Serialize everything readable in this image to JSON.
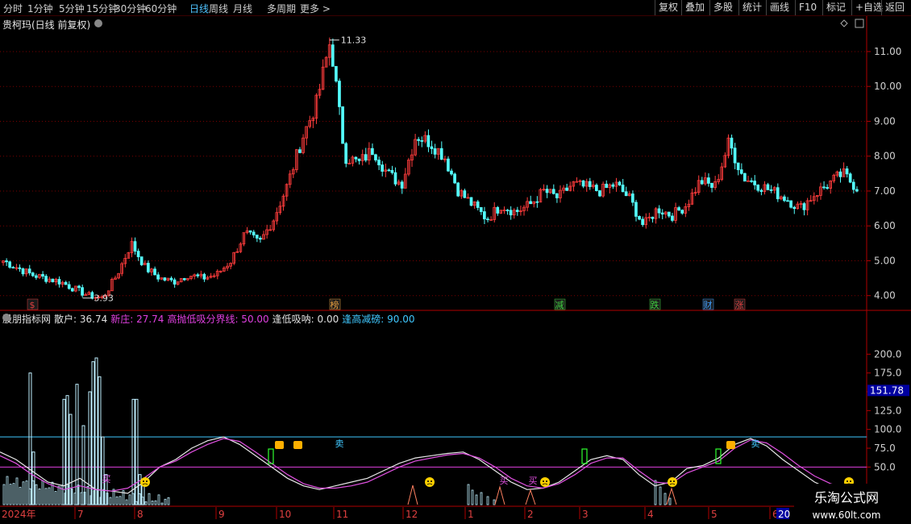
{
  "toolbar": {
    "periods": [
      "分时",
      "1分钟",
      "5分钟",
      "15分钟",
      "30分钟",
      "60分钟",
      "日线",
      "周线",
      "月线",
      "多周期",
      "更多 >"
    ],
    "active_period": "日线",
    "buttons": [
      "复权",
      "叠加",
      "多股",
      "统计",
      "画线",
      "F10",
      "标记",
      "+自选",
      "返回"
    ]
  },
  "price_panel": {
    "title": "贵柯玛(日线 前复权)",
    "high_label": "11.33",
    "low_label": "3.93",
    "event_markers": [
      {
        "text": "$",
        "color": "#e04040"
      },
      {
        "text": "榜",
        "color": "#e8a040"
      },
      {
        "text": "减",
        "color": "#40d040"
      },
      {
        "text": "跌",
        "color": "#40d040"
      },
      {
        "text": "财",
        "color": "#40a0ff"
      },
      {
        "text": "涨",
        "color": "#e04040"
      }
    ]
  },
  "indicator_panel": {
    "name": "股朋指标网",
    "items": [
      {
        "label": "散户: 36.74",
        "color": "#e0e0e0"
      },
      {
        "label": "新庄: 27.74",
        "color": "#e040e0"
      },
      {
        "label": "高抛低吸分界线: 50.00",
        "color": "#e040e0"
      },
      {
        "label": "逢低吸呐: 0.00",
        "color": "#e0e0e0"
      },
      {
        "label": "逢高减磅: 90.00",
        "color": "#40c8ff"
      }
    ],
    "current_value": "151.78",
    "buy_label": "买",
    "sell_label": "卖"
  },
  "date_axis": {
    "labels": [
      "2024年",
      "7",
      "8",
      "9",
      "10",
      "11",
      "12",
      "1",
      "2",
      "3",
      "4",
      "5",
      "6",
      "20"
    ]
  },
  "watermark": {
    "name": "乐淘公式网",
    "url": "www.60lt.com"
  },
  "colors": {
    "up": "#ff3c3c",
    "down": "#54ffff",
    "axis": "#b00000",
    "sanhu": "#e8e8e8",
    "xinzhuang": "#e050e0",
    "upper_line": "#40c8ff",
    "mid_line": "#e040e0"
  },
  "chart_data": [
    {
      "type": "candlestick",
      "title": "贵柯玛(日线 前复权)",
      "ylim": [
        3.6,
        11.6
      ],
      "y_ticks": [
        4.0,
        5.0,
        6.0,
        7.0,
        8.0,
        9.0,
        10.0,
        11.0
      ],
      "x_start": "2024年",
      "price_path_weekly_close": [
        5.0,
        4.8,
        4.6,
        4.5,
        4.4,
        4.2,
        4.0,
        3.93,
        4.6,
        5.5,
        4.8,
        4.5,
        4.4,
        4.6,
        4.5,
        4.6,
        5.0,
        5.8,
        5.5,
        6.2,
        7.2,
        8.5,
        9.5,
        11.33,
        8.0,
        7.8,
        8.2,
        7.5,
        7.2,
        8.6,
        8.4,
        8.0,
        7.0,
        6.6,
        6.2,
        6.6,
        6.4,
        6.6,
        7.0,
        6.8,
        7.2,
        7.1,
        7.0,
        7.2,
        6.8,
        6.0,
        6.5,
        6.3,
        6.6,
        7.3,
        7.1,
        8.4,
        7.4,
        7.2,
        7.0,
        6.8,
        6.5,
        6.9,
        7.2,
        7.5,
        7.1
      ],
      "annotations": [
        {
          "text": "11.33",
          "type": "high"
        },
        {
          "text": "3.93",
          "type": "low"
        }
      ]
    },
    {
      "type": "line",
      "title": "股朋指标网",
      "ylim": [
        0,
        240
      ],
      "y_ticks": [
        50.0,
        75.0,
        100.0,
        125.0,
        150.0,
        175.0,
        200.0
      ],
      "series": [
        {
          "name": "散户",
          "values": [
            70,
            60,
            45,
            30,
            25,
            35,
            20,
            18,
            15,
            30,
            50,
            60,
            75,
            85,
            90,
            80,
            65,
            50,
            35,
            25,
            20,
            25,
            30,
            35,
            45,
            55,
            62,
            65,
            68,
            70,
            60,
            45,
            30,
            20,
            22,
            30,
            45,
            60,
            65,
            60,
            40,
            25,
            30,
            48,
            52,
            62,
            80,
            88,
            78,
            60,
            45,
            30,
            20,
            15
          ]
        },
        {
          "name": "新庄",
          "values": [
            65,
            55,
            40,
            28,
            20,
            25,
            20,
            18,
            22,
            35,
            50,
            58,
            70,
            80,
            88,
            84,
            70,
            55,
            40,
            28,
            22,
            22,
            25,
            30,
            40,
            50,
            58,
            62,
            66,
            68,
            62,
            50,
            35,
            25,
            22,
            28,
            40,
            55,
            62,
            62,
            45,
            30,
            28,
            42,
            50,
            58,
            75,
            86,
            82,
            68,
            52,
            38,
            28,
            22
          ]
        },
        {
          "name": "高抛低吸分界线",
          "values": [
            50
          ]
        },
        {
          "name": "逢高减磅",
          "values": [
            90
          ]
        }
      ],
      "current_value": 151.78
    }
  ]
}
